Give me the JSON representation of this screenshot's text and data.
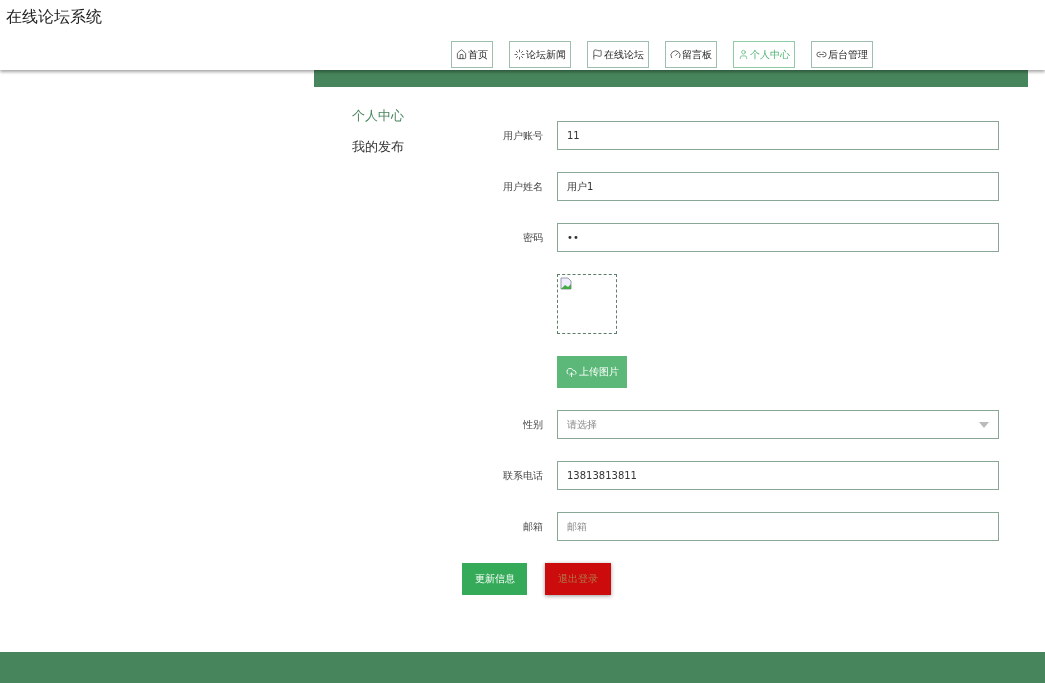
{
  "site_title": "在线论坛系统",
  "nav": [
    {
      "label": "首页",
      "kind": "home",
      "selected": false
    },
    {
      "label": "论坛新闻",
      "kind": "news",
      "selected": false
    },
    {
      "label": "在线论坛",
      "kind": "forum",
      "selected": false
    },
    {
      "label": "留言板",
      "kind": "board",
      "selected": false
    },
    {
      "label": "个人中心",
      "kind": "profile",
      "selected": true
    },
    {
      "label": "后台管理",
      "kind": "admin",
      "selected": false
    }
  ],
  "sidebar": [
    {
      "label": "个人中心",
      "selected": true
    },
    {
      "label": "我的发布",
      "selected": false
    }
  ],
  "form": [
    {
      "kind": "text",
      "label": "用户账号",
      "value": "11"
    },
    {
      "kind": "text",
      "label": "用户姓名",
      "value": "用户1"
    },
    {
      "kind": "password",
      "label": "密码",
      "value": "••"
    },
    {
      "kind": "image",
      "button": "上传图片"
    },
    {
      "kind": "select",
      "label": "性别",
      "placeholder": "请选择"
    },
    {
      "kind": "text",
      "label": "联系电话",
      "value": "13813813811"
    },
    {
      "kind": "text",
      "label": "邮箱",
      "placeholder": "邮箱"
    }
  ],
  "buttons": [
    {
      "label": "更新信息",
      "kind": "primary"
    },
    {
      "label": "退出登录",
      "kind": "danger"
    }
  ]
}
